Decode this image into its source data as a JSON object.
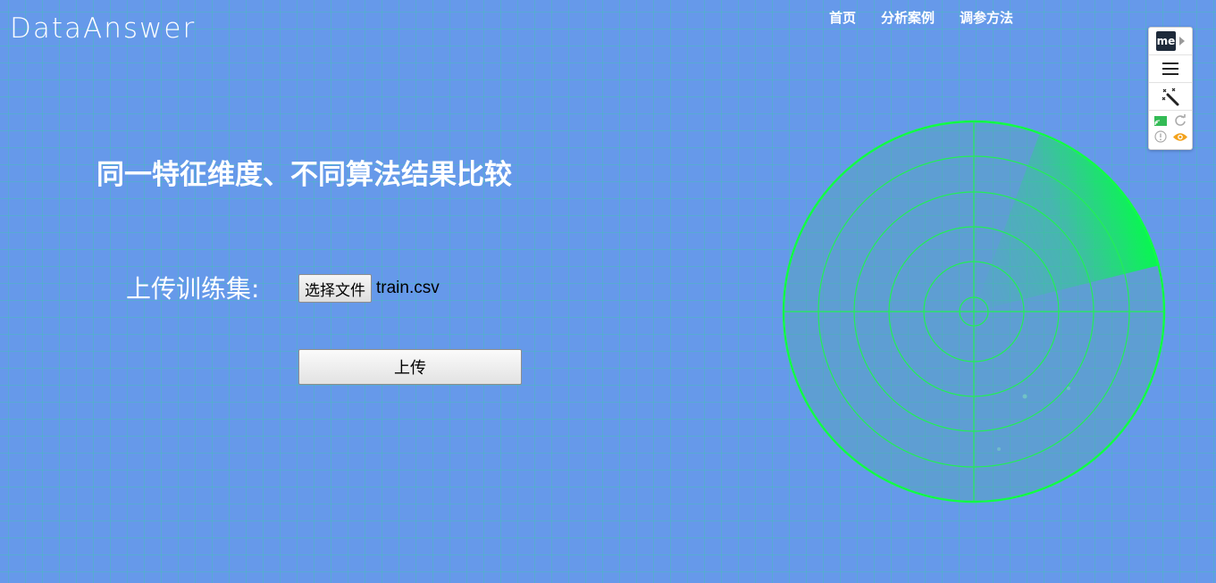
{
  "logo": {
    "text": "DataAnswer"
  },
  "nav": {
    "items": [
      {
        "label": "首页"
      },
      {
        "label": "分析案例"
      },
      {
        "label": "调参方法"
      }
    ]
  },
  "main": {
    "title": "同一特征维度、不同算法结果比较",
    "upload_label": "上传训练集:",
    "file_button_label": "选择文件",
    "file_name": "train.csv",
    "submit_label": "上传"
  },
  "extension_toolbar": {
    "badge_text": "me",
    "icons": [
      "me-logo-icon",
      "menu-icon",
      "magic-wand-icon",
      "cast-icon",
      "refresh-icon",
      "alert-icon",
      "eye-icon"
    ]
  },
  "colors": {
    "background": "#6699ea",
    "grid": "#3cc8aa",
    "radar": "#00ff44",
    "text": "#ffffff"
  }
}
